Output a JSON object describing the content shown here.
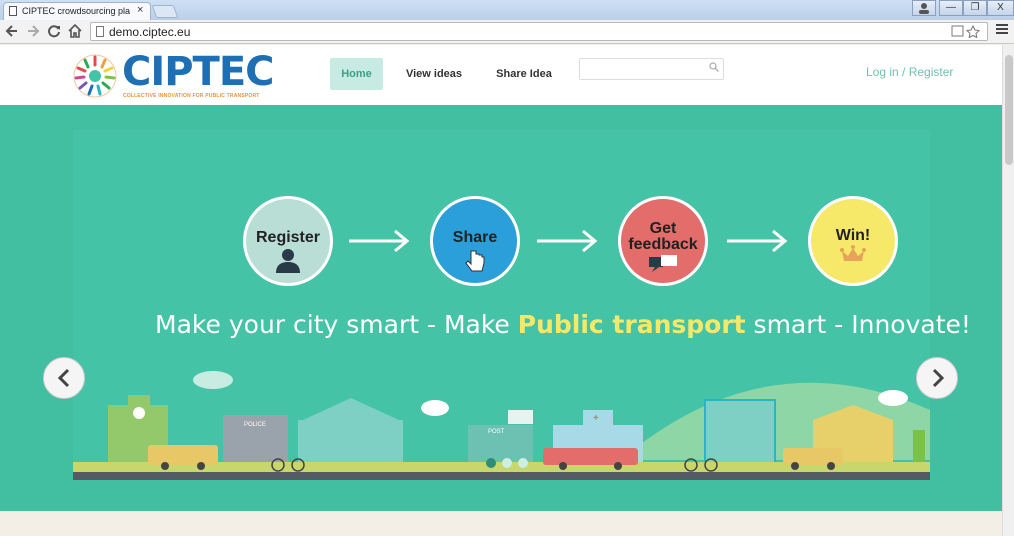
{
  "browser": {
    "tab_title": "CIPTEC crowdsourcing pla",
    "tab_close": "×",
    "url": "demo.ciptec.eu",
    "win_minimize": "—",
    "win_restore": "❐",
    "win_close": "X"
  },
  "site": {
    "logo_text": "CIPTEC",
    "logo_tagline": "COLLECTIVE INNOVATION FOR PUBLIC TRANSPORT",
    "nav": {
      "home": "Home",
      "view_ideas": "View ideas",
      "share_idea": "Share Idea"
    },
    "search_placeholder": "",
    "login": "Log in / Register",
    "steps": [
      {
        "label": "Register",
        "icon": "person-icon",
        "color": "#b9ded6"
      },
      {
        "label": "Share",
        "icon": "hand-cursor-icon",
        "color": "#2b9fd9"
      },
      {
        "label": "Get feedback",
        "icon": "chat-icon",
        "color": "#e26d6a"
      },
      {
        "label": "Win!",
        "icon": "crown-icon",
        "color": "#f6e96a"
      }
    ],
    "tagline_pre": "Make your city smart - Make ",
    "tagline_highlight": "Public transport",
    "tagline_post": " smart - Innovate!",
    "city_signs": {
      "police": "POLICE",
      "post": "POST"
    },
    "carousel": {
      "slides": 3,
      "active_slide": 1
    },
    "colors": {
      "hero_bg": "#42bea1",
      "accent_yellow": "#f6e96a",
      "logo_blue": "#1e6fb3",
      "logo_orange": "#e9913a"
    }
  }
}
